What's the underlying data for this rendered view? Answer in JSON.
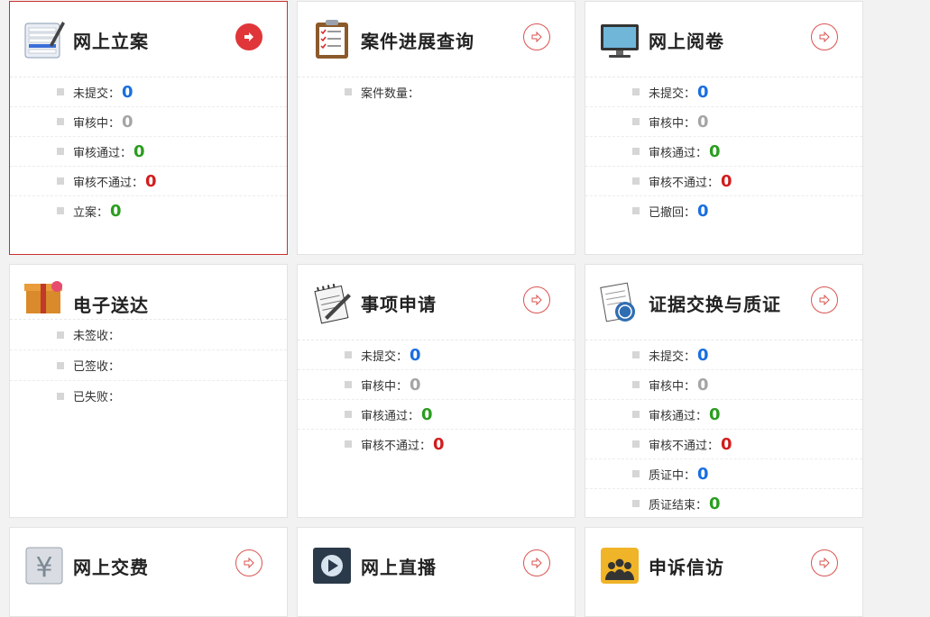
{
  "cards": [
    {
      "title": "网上立案",
      "rows": [
        {
          "label": "未提交：",
          "value": "0",
          "color": "blue"
        },
        {
          "label": "审核中：",
          "value": "0",
          "color": "gray"
        },
        {
          "label": "审核通过：",
          "value": "0",
          "color": "green"
        },
        {
          "label": "审核不通过：",
          "value": "0",
          "color": "red"
        },
        {
          "label": "立案：",
          "value": "0",
          "color": "green"
        }
      ]
    },
    {
      "title": "案件进展查询",
      "rows": [
        {
          "label": "案件数量：",
          "value": "",
          "color": ""
        }
      ]
    },
    {
      "title": "网上阅卷",
      "rows": [
        {
          "label": "未提交：",
          "value": "0",
          "color": "blue"
        },
        {
          "label": "审核中：",
          "value": "0",
          "color": "gray"
        },
        {
          "label": "审核通过：",
          "value": "0",
          "color": "green"
        },
        {
          "label": "审核不通过：",
          "value": "0",
          "color": "red"
        },
        {
          "label": "已撤回：",
          "value": "0",
          "color": "blue"
        }
      ]
    },
    {
      "title": "电子送达",
      "rows": [
        {
          "label": "未签收：",
          "value": "",
          "color": ""
        },
        {
          "label": "已签收：",
          "value": "",
          "color": ""
        },
        {
          "label": "已失败：",
          "value": "",
          "color": ""
        }
      ]
    },
    {
      "title": "事项申请",
      "rows": [
        {
          "label": "未提交：",
          "value": "0",
          "color": "blue"
        },
        {
          "label": "审核中：",
          "value": "0",
          "color": "gray"
        },
        {
          "label": "审核通过：",
          "value": "0",
          "color": "green"
        },
        {
          "label": "审核不通过：",
          "value": "0",
          "color": "red"
        }
      ]
    },
    {
      "title": "证据交换与质证",
      "rows": [
        {
          "label": "未提交：",
          "value": "0",
          "color": "blue"
        },
        {
          "label": "审核中：",
          "value": "0",
          "color": "gray"
        },
        {
          "label": "审核通过：",
          "value": "0",
          "color": "green"
        },
        {
          "label": "审核不通过：",
          "value": "0",
          "color": "red"
        },
        {
          "label": "质证中：",
          "value": "0",
          "color": "blue"
        },
        {
          "label": "质证结束：",
          "value": "0",
          "color": "green"
        }
      ]
    },
    {
      "title": "网上交费",
      "rows": []
    },
    {
      "title": "网上直播",
      "rows": []
    },
    {
      "title": "申诉信访",
      "rows": []
    }
  ],
  "colors": {
    "accent": "#e0363a",
    "blue": "#1a6ee0",
    "gray": "#a5a5a5",
    "green": "#2a9d1f",
    "red": "#d11d1d"
  }
}
